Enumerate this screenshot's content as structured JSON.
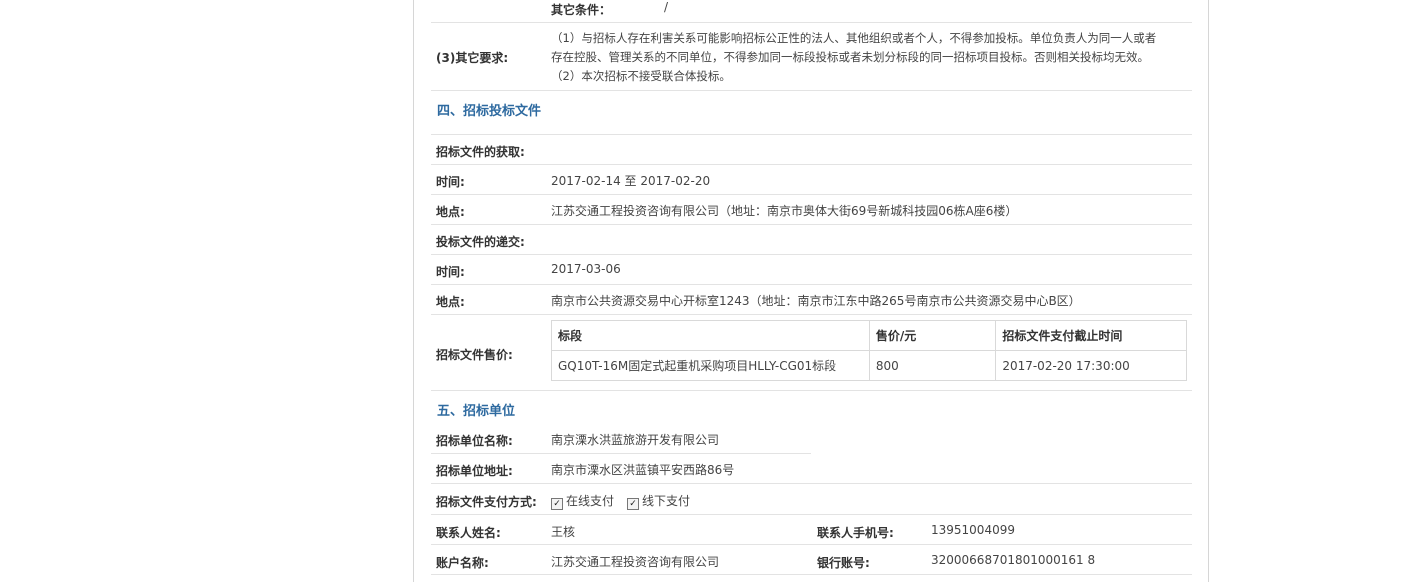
{
  "top": {
    "other_conditions_label": "其它条件：",
    "other_conditions_value": "/"
  },
  "requirements": {
    "label": "(3)其它要求:",
    "lines": [
      "（1）与招标人存在利害关系可能影响招标公正性的法人、其他组织或者个人，不得参加投标。单位负责人为同一人或者",
      "存在控股、管理关系的不同单位，不得参加同一标段投标或者未划分标段的同一招标项目投标。否则相关投标均无效。",
      "（2）本次招标不接受联合体投标。"
    ]
  },
  "section4": {
    "title": "四、招标投标文件",
    "obtain_label": "招标文件的获取:",
    "obtain_time_label": "时间:",
    "obtain_time_value": "2017-02-14 至 2017-02-20",
    "obtain_place_label": "地点:",
    "obtain_place_value": "江苏交通工程投资咨询有限公司（地址：南京市奥体大街69号新城科技园06栋A座6楼）",
    "submit_label": "投标文件的递交:",
    "submit_time_label": "时间:",
    "submit_time_value": "2017-03-06",
    "submit_place_label": "地点:",
    "submit_place_value": "南京市公共资源交易中心开标室1243（地址：南京市江东中路265号南京市公共资源交易中心B区）",
    "price_label": "招标文件售价:",
    "price_table": {
      "headers": [
        "标段",
        "售价/元",
        "招标文件支付截止时间"
      ],
      "rows": [
        [
          "GQ10T-16M固定式起重机采购项目HLLY-CG01标段",
          "800",
          "2017-02-20 17:30:00"
        ]
      ]
    }
  },
  "section5": {
    "title": "五、招标单位",
    "unit_name_label": "招标单位名称:",
    "unit_name_value": "南京溧水洪蓝旅游开发有限公司",
    "unit_addr_label": "招标单位地址:",
    "unit_addr_value": "南京市溧水区洪蓝镇平安西路86号",
    "pay_label": "招标文件支付方式:",
    "pay_online": "在线支付",
    "pay_offline": "线下支付",
    "contact_name_label": "联系人姓名:",
    "contact_name_value": "王核",
    "contact_phone_label": "联系人手机号:",
    "contact_phone_value": "13951004099",
    "account_name_label": "账户名称:",
    "account_name_value": "江苏交通工程投资咨询有限公司",
    "bank_account_label": "银行账号:",
    "bank_account_value": "32000668701801000161 8"
  }
}
